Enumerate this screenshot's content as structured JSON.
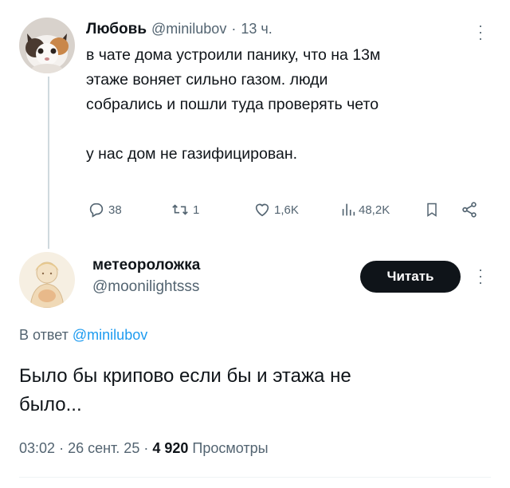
{
  "parent_tweet": {
    "display_name": "Любовь",
    "handle": "@minilubov",
    "separator": "·",
    "time": "13 ч.",
    "text_line1": "в чате дома устроили панику, что на 13м",
    "text_line2": "этаже воняет сильно газом. люди",
    "text_line3": "собрались и пошли туда проверять чето",
    "text_line4": "у нас дом не газифицирован.",
    "replies": "38",
    "retweets": "1",
    "likes": "1,6K",
    "views": "48,2K"
  },
  "reply_tweet": {
    "display_name": "метеороложка",
    "handle": "@moonilightsss",
    "follow_label": "Читать",
    "in_reply_prefix": "В ответ",
    "in_reply_handle": "@minilubov",
    "text_line1": "Было бы крипово если бы и этажа не",
    "text_line2": "было...",
    "time": "03:02",
    "date": "26 сент. 25",
    "sep": "·",
    "views_count": "4 920",
    "views_label": "Просмотры"
  },
  "icons": {
    "reply": "reply-icon",
    "retweet": "retweet-icon",
    "like": "heart-icon",
    "views": "views-icon",
    "bookmark": "bookmark-icon",
    "share": "share-icon",
    "more": "more-icon"
  },
  "colors": {
    "text": "#0f1419",
    "muted": "#536471",
    "link": "#1d9bf0",
    "button": "#0f1419"
  }
}
